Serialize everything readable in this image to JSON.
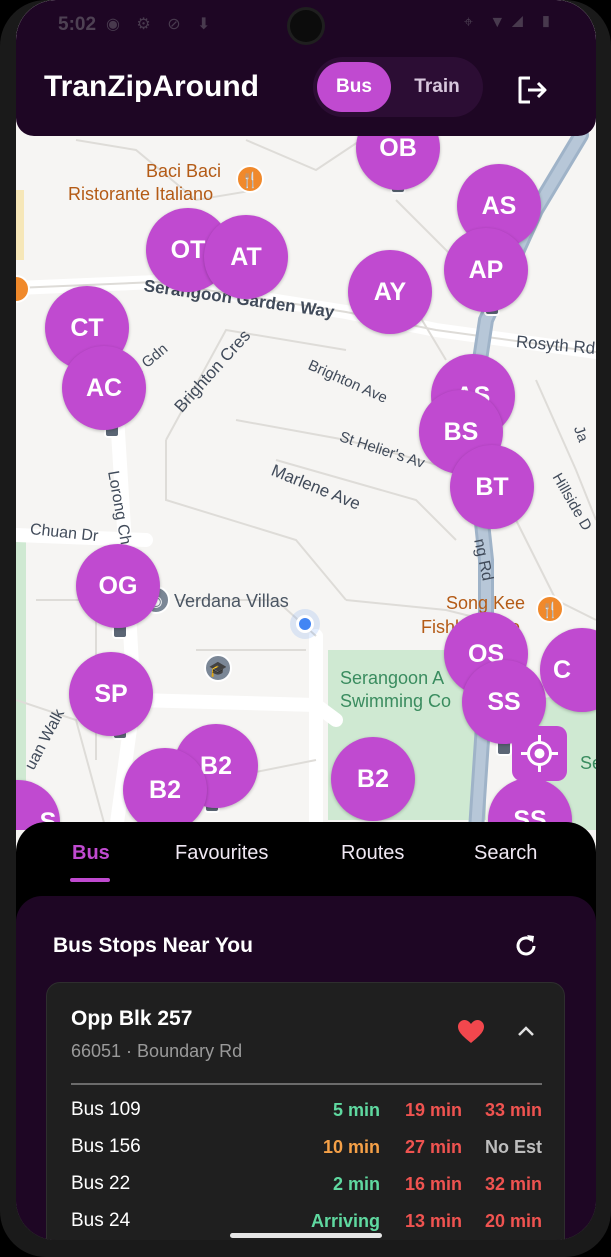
{
  "status_bar": {
    "time": "5:02",
    "left_icons": "◉ ⚙ ⊘ ⬇",
    "right_icons": "⌖ ▼◢ ▮"
  },
  "app_bar": {
    "title": "TranZipAround",
    "modes": [
      "Bus",
      "Train"
    ],
    "selected_mode": "Bus",
    "logout_icon": "logout-icon"
  },
  "map": {
    "poi": {
      "baci_line1": "Baci Baci",
      "baci_line2": "Ristorante Italiano",
      "verdana": "Verdana Villas",
      "songkee_line1": "Song Kee",
      "songkee_line2": "Fishball",
      "songkee_cut": "e",
      "swim_line1": "Serangoon A",
      "swim_line2": "Swimming Co",
      "sr_cut": "Se"
    },
    "streets": {
      "garden_way": "Serangoon Garden Way",
      "brighton_cres": "Brighton Cres",
      "brighton_ave": "Brighton Ave",
      "st_helier": "St Helier's Av",
      "marlene": "Marlene Ave",
      "rosyth": "Rosyth Rd",
      "hillside": "Hillside D",
      "chuan_dr": "Chuan Dr",
      "lorong": "Lorong Ch",
      "chuan_walk": "uan Walk",
      "an_gdn": "an Gdn",
      "ng_rd": "ng Rd",
      "ja": "Ja"
    },
    "markers": [
      "OB",
      "AS",
      "OT",
      "AT",
      "AP",
      "AY",
      "CT",
      "AC",
      "AS",
      "BS",
      "BT",
      "OG",
      "OS",
      "SS",
      "SP",
      "B2",
      "B2",
      "B2",
      "SS",
      "C",
      "S"
    ]
  },
  "tabs": [
    "Bus",
    "Favourites",
    "Routes",
    "Search"
  ],
  "active_tab": "Bus",
  "nearby": {
    "title": "Bus Stops Near You",
    "stop": {
      "name": "Opp Blk 257",
      "code_road": "66051 · Boundary Rd",
      "favourite": true
    },
    "services": [
      {
        "label": "Bus 109",
        "etas": [
          "5 min",
          "19 min",
          "33 min"
        ]
      },
      {
        "label": "Bus 156",
        "etas": [
          "10 min",
          "27 min",
          "No Est"
        ]
      },
      {
        "label": "Bus 22",
        "etas": [
          "2 min",
          "16 min",
          "32 min"
        ]
      },
      {
        "label": "Bus 24",
        "etas": [
          "Arriving",
          "13 min",
          "20 min"
        ]
      }
    ]
  },
  "colors": {
    "accent": "#c04ad0",
    "app_bar": "#1e0624",
    "eta_green": "#5fd9a0",
    "eta_orange": "#f5a047",
    "eta_red": "#ef5350",
    "eta_gray": "#bdbdbd"
  }
}
